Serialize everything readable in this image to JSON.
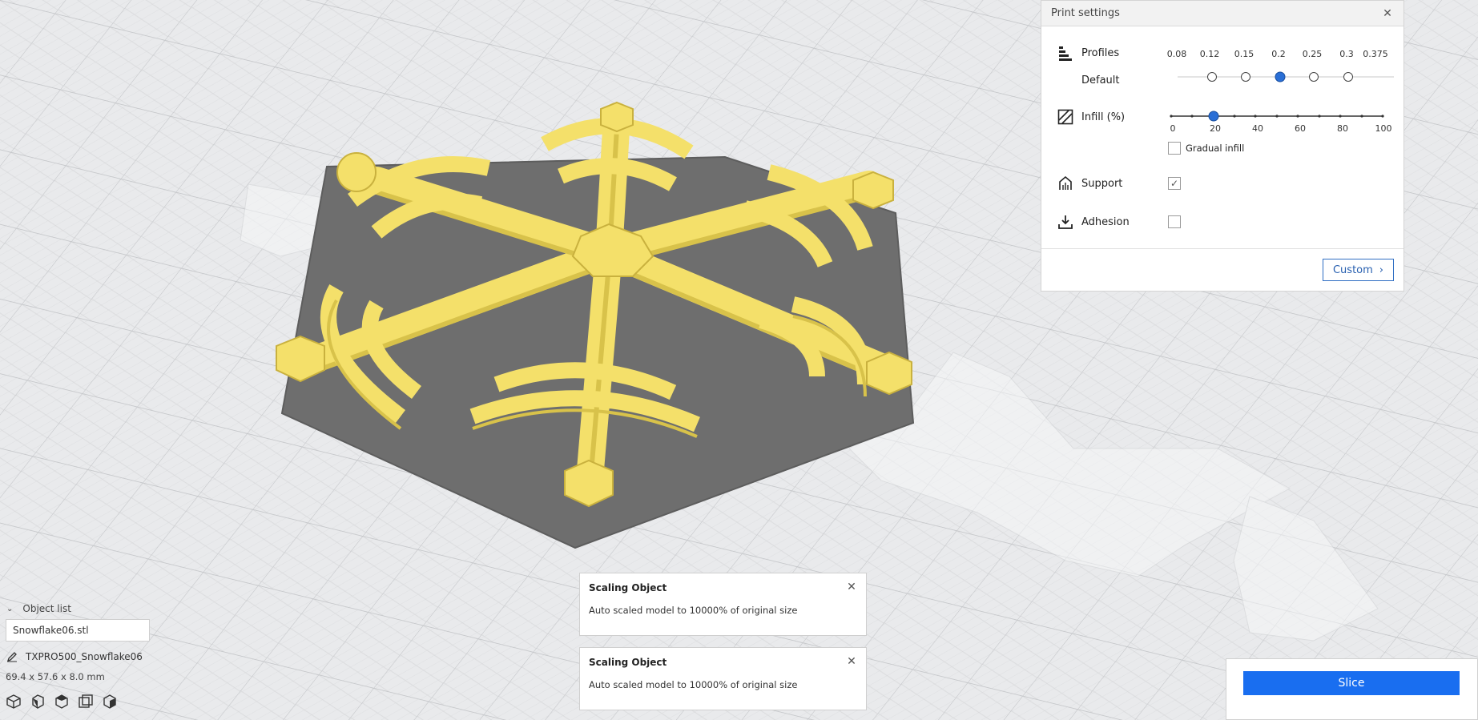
{
  "colors": {
    "accent": "#196ef0",
    "model": "#f4e06a",
    "model_shadow": "#d8c24a",
    "plate": "#6e6e6e",
    "grid": "#c9cbce",
    "background": "#e9eaec"
  },
  "print_settings": {
    "title": "Print settings",
    "close_icon": "close-icon",
    "profiles": {
      "label": "Profiles",
      "sub_label": "Default",
      "icon": "layers-icon",
      "values": [
        "0.08",
        "0.12",
        "0.15",
        "0.2",
        "0.25",
        "0.3",
        "0.375"
      ],
      "selected": "0.2"
    },
    "infill": {
      "label": "Infill (%)",
      "icon": "infill-icon",
      "tick_labels": [
        "0",
        "20",
        "40",
        "60",
        "80",
        "100"
      ],
      "value": 20
    },
    "gradual_infill": {
      "label": "Gradual infill",
      "checked": false
    },
    "support": {
      "label": "Support",
      "icon": "support-icon",
      "checked": true
    },
    "adhesion": {
      "label": "Adhesion",
      "icon": "adhesion-icon",
      "checked": false
    },
    "custom_button": "Custom"
  },
  "toasts": [
    {
      "title": "Scaling Object",
      "message": "Auto scaled model to 10000% of original size"
    },
    {
      "title": "Scaling Object",
      "message": "Auto scaled model to 10000% of original size"
    }
  ],
  "object_list": {
    "header": "Object list",
    "selected_file": "Snowflake06.stl",
    "object_name": "TXPRO500_Snowflake06",
    "dimensions": "69.4 x 57.6 x 8.0 mm"
  },
  "slice_button": "Slice"
}
